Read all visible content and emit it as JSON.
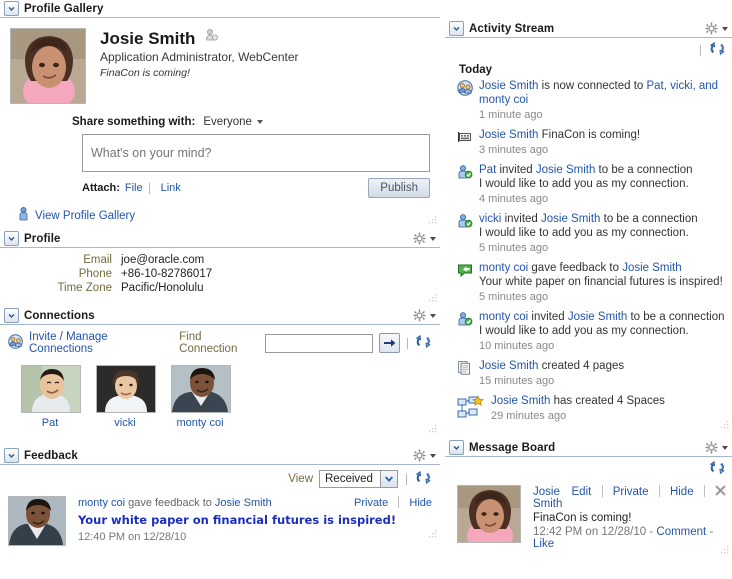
{
  "profile_gallery": {
    "title": "Profile Gallery",
    "collapse_icon": "chevron-down-icon",
    "user": {
      "name": "Josie Smith",
      "status_icon": "presence-icon",
      "title": "Application Administrator, WebCenter",
      "note": "FinaCon is coming!"
    },
    "share": {
      "label": "Share something with:",
      "audience": "Everyone",
      "caret_icon": "caret-down-icon",
      "message_placeholder": "What's on your mind?",
      "message_value": "",
      "attach_label": "Attach:",
      "attach_file": "File",
      "attach_link": "Link",
      "publish_label": "Publish"
    },
    "view_gallery_link": "View Profile Gallery",
    "view_gallery_icon": "person-icon"
  },
  "profile": {
    "title": "Profile",
    "gear_icon": "gear-icon",
    "rows": [
      {
        "key": "Email",
        "value": "joe@oracle.com"
      },
      {
        "key": "Phone",
        "value": "+86-10-82786017"
      },
      {
        "key": "Time Zone",
        "value": "Pacific/Honolulu"
      }
    ]
  },
  "connections": {
    "title": "Connections",
    "gear_icon": "gear-icon",
    "invite_link": "Invite / Manage Connections",
    "invite_icon": "people-icon",
    "find_label": "Find Connection",
    "find_value": "",
    "go_icon": "arrow-right-icon",
    "refresh_icon": "refresh-icon",
    "people": [
      {
        "name": "Pat"
      },
      {
        "name": "vicki"
      },
      {
        "name": "monty coi"
      }
    ]
  },
  "feedback": {
    "title": "Feedback",
    "gear_icon": "gear-icon",
    "view_label": "View",
    "view_value": "Received",
    "refresh_icon": "refresh-icon",
    "item": {
      "author": "monty coi",
      "action": "gave feedback to",
      "recipient": "Josie Smith",
      "private_link": "Private",
      "hide_link": "Hide",
      "message": "Your white paper on financial futures is inspired!",
      "time": "12:40 PM on 12/28/10"
    }
  },
  "activity_stream": {
    "title": "Activity Stream",
    "gear_icon": "gear-icon",
    "refresh_icon": "refresh-icon",
    "group_label": "Today",
    "items": [
      {
        "icon": "connection-icon",
        "actor": "Josie Smith",
        "text": " is now connected to ",
        "targets": "Pat, vicki, and monty coi",
        "detail": "",
        "time": "1 minute ago"
      },
      {
        "icon": "message-board-icon",
        "actor": "Josie Smith",
        "text": " FinaCon is coming!",
        "targets": "",
        "detail": "",
        "time": "3 minutes ago"
      },
      {
        "icon": "invite-icon",
        "actor": "Pat",
        "text": " invited ",
        "targets": "Josie Smith",
        "tail": " to be a connection",
        "detail": "I would like to add you as my connection.",
        "time": "4 minutes ago"
      },
      {
        "icon": "invite-icon",
        "actor": "vicki",
        "text": " invited ",
        "targets": "Josie Smith",
        "tail": " to be a connection",
        "detail": "I would like to add you as my connection.",
        "time": "5 minutes ago"
      },
      {
        "icon": "feedback-icon",
        "actor": "monty coi",
        "text": " gave feedback to ",
        "targets": "Josie Smith",
        "tail": "",
        "detail": "Your white paper on financial futures is inspired!",
        "time": "5 minutes ago"
      },
      {
        "icon": "invite-icon",
        "actor": "monty coi",
        "text": " invited ",
        "targets": "Josie Smith",
        "tail": " to be a connection",
        "detail": "I would like to add you as my connection.",
        "time": "10 minutes ago"
      },
      {
        "icon": "pages-icon",
        "actor": "Josie Smith",
        "text": " created 4 pages",
        "targets": "",
        "detail": "",
        "time": "15 minutes ago"
      },
      {
        "icon": "spaces-icon",
        "actor": "Josie Smith",
        "text": " has created 4 Spaces",
        "targets": "",
        "detail": "",
        "time": "29 minutes ago"
      }
    ]
  },
  "message_board": {
    "title": "Message Board",
    "gear_icon": "gear-icon",
    "refresh_icon": "refresh-icon",
    "item": {
      "author": "Josie Smith",
      "edit": "Edit",
      "private": "Private",
      "hide": "Hide",
      "delete_icon": "delete-icon",
      "message": "FinaCon is coming!",
      "time": "12:42 PM on 12/28/10",
      "comment": "Comment",
      "like": "Like"
    }
  },
  "colors": {
    "link": "#2255aa",
    "header_rule": "#a6b8cf",
    "label_olive": "#756a3e",
    "feedback_text": "#1a2fbf"
  }
}
